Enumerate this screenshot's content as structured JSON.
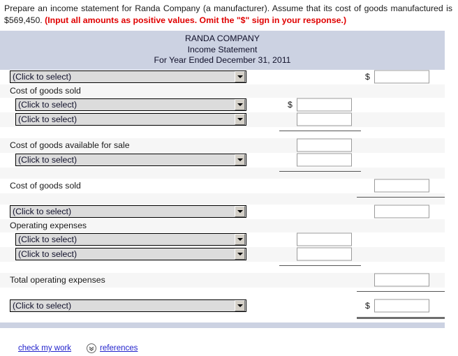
{
  "prompt": {
    "text": "Prepare an income statement for Randa Company (a manufacturer). Assume that its cost of goods manufactured is $569,450.",
    "note": "(Input all amounts as positive values. Omit the \"$\" sign in your response.)"
  },
  "statement": {
    "company": "RANDA COMPANY",
    "title": "Income Statement",
    "period": "For Year Ended December 31, 2011"
  },
  "labels": {
    "select_placeholder": "(Click to select)",
    "cost_of_goods_sold_header": "Cost of goods sold",
    "cost_of_goods_available": "Cost of goods available for sale",
    "cost_of_goods_sold_total": "Cost of goods sold",
    "operating_expenses_header": "Operating expenses",
    "total_operating_expenses": "Total operating expenses",
    "dollar": "$"
  },
  "fields": {
    "sales_amount": "",
    "beginning_inventory": "",
    "cost_of_goods_manufactured": "",
    "goods_available_amount": "",
    "ending_inventory": "",
    "cogs_total_amount": "",
    "gross_profit_amount": "",
    "expense_one": "",
    "expense_two": "",
    "total_opex_amount": "",
    "net_income_amount": ""
  },
  "footer": {
    "check_my_work": "check my work",
    "references": "references",
    "chevron_icon": "double-chevron-down-icon"
  },
  "colors": {
    "band": "#ccd2e2",
    "note": "#e00000",
    "link": "#2222cc",
    "stripe": "#f6f6f6",
    "select_face": "#dcdcdc"
  }
}
